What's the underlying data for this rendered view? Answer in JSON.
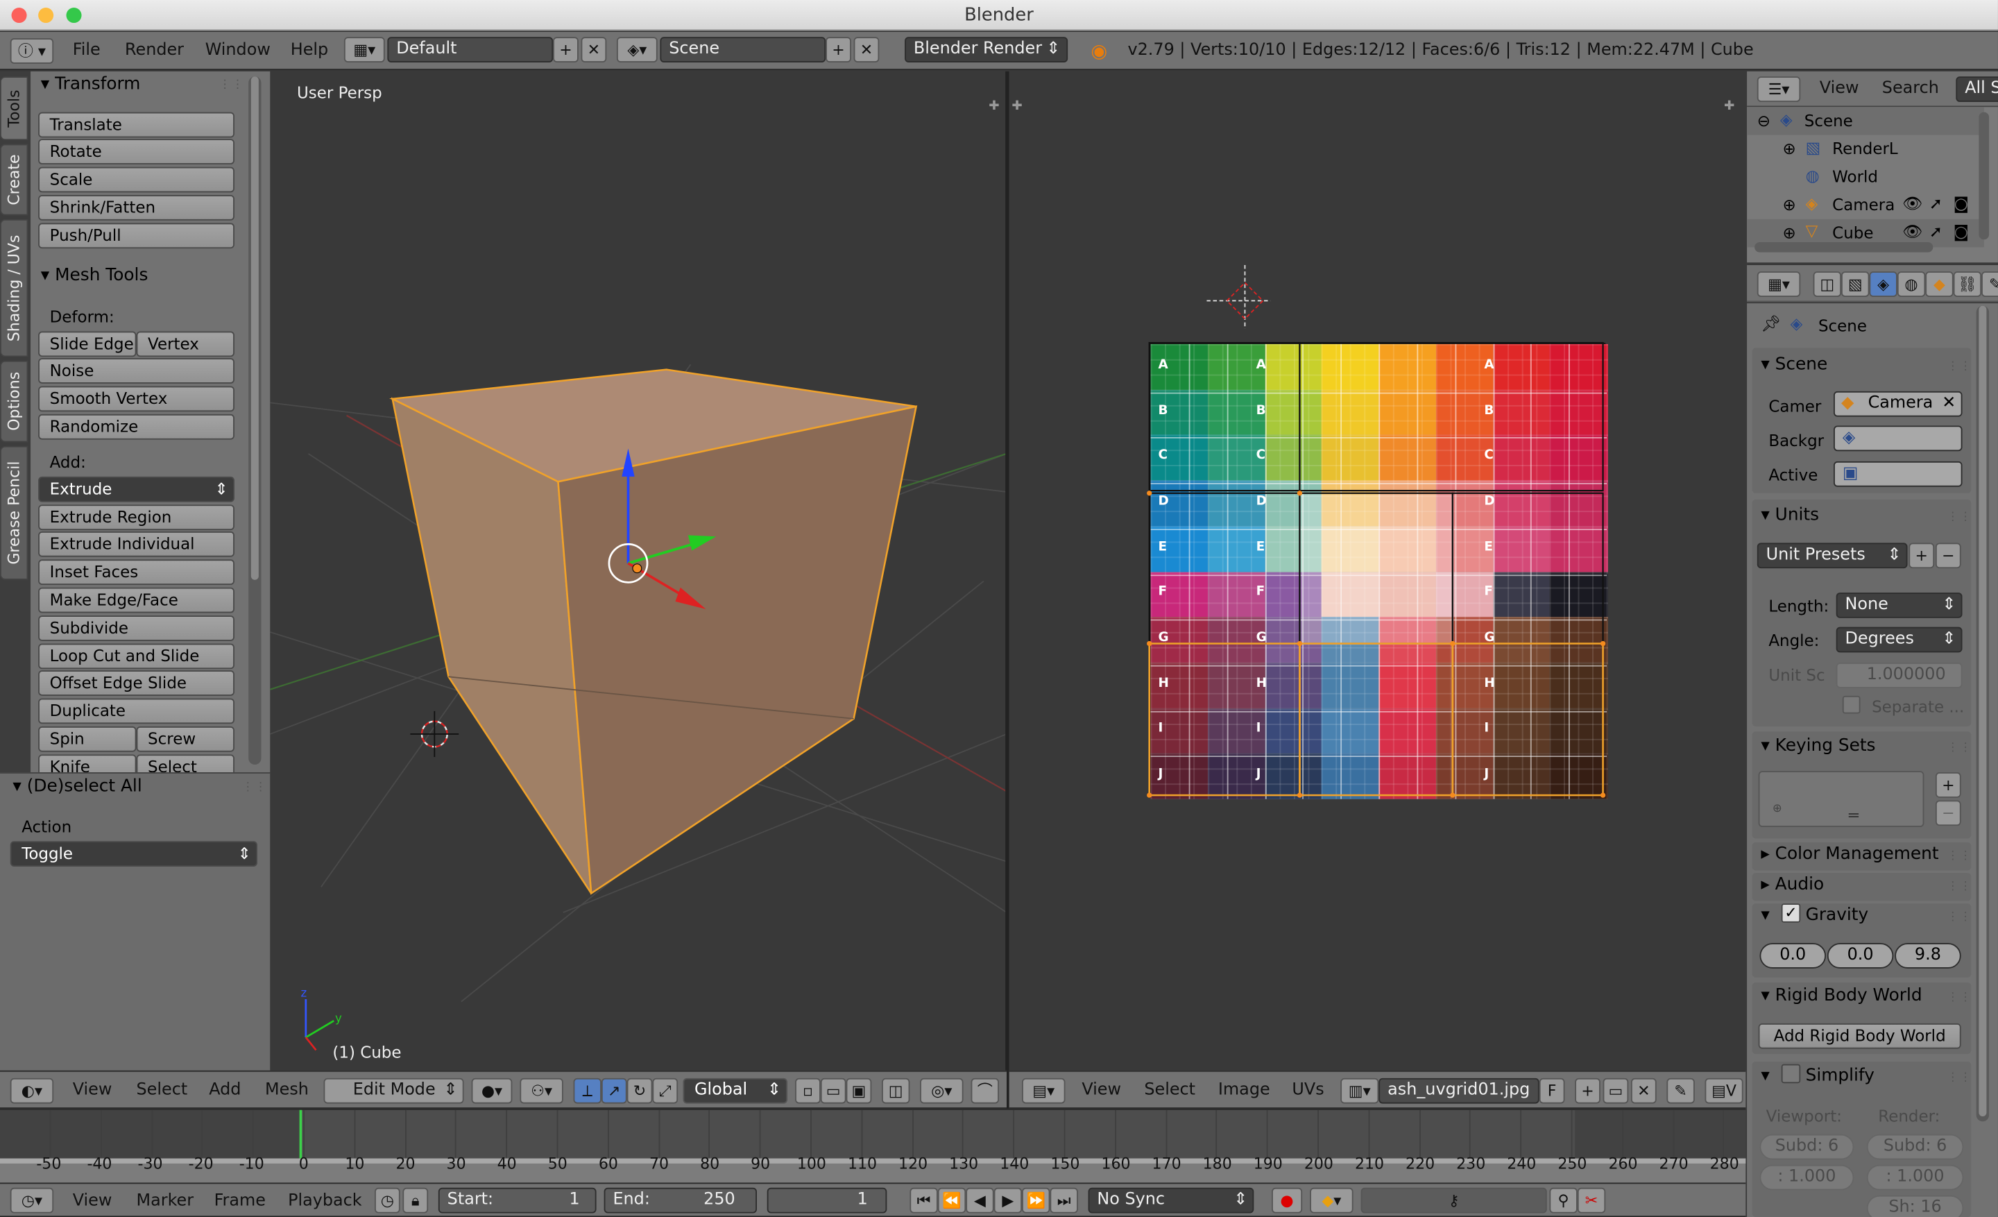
{
  "window": {
    "title": "Blender"
  },
  "info_header": {
    "menus": [
      "File",
      "Render",
      "Window",
      "Help"
    ],
    "layout": "Default",
    "scene": "Scene",
    "engine": "Blender Render",
    "stats": "v2.79 | Verts:10/10 | Edges:12/12 | Faces:6/6 | Tris:12 | Mem:22.47M | Cube"
  },
  "tool_tabs": [
    "Tools",
    "Create",
    "Shading / UVs",
    "Options",
    "Grease Pencil"
  ],
  "toolshelf": {
    "transform_title": "Transform",
    "transform_buttons": [
      "Translate",
      "Rotate",
      "Scale",
      "Shrink/Fatten",
      "Push/Pull"
    ],
    "mesh_tools_title": "Mesh Tools",
    "deform_label": "Deform:",
    "slide_edge": "Slide Edge",
    "vertex": "Vertex",
    "deform_buttons": [
      "Noise",
      "Smooth Vertex",
      "Randomize"
    ],
    "add_label": "Add:",
    "extrude": "Extrude",
    "add_buttons": [
      "Extrude Region",
      "Extrude Individual",
      "Inset Faces",
      "Make Edge/Face",
      "Subdivide",
      "Loop Cut and Slide",
      "Offset Edge Slide",
      "Duplicate"
    ],
    "spin": "Spin",
    "screw": "Screw",
    "knife": "Knife",
    "select": "Select"
  },
  "operator_panel": {
    "title": "(De)select All",
    "action_label": "Action",
    "action_value": "Toggle"
  },
  "viewport": {
    "view_label": "User Persp",
    "object_label": "(1) Cube"
  },
  "view3d_header": {
    "menus": [
      "View",
      "Select",
      "Add",
      "Mesh"
    ],
    "mode": "Edit Mode",
    "orientation": "Global"
  },
  "uv_header": {
    "menus": [
      "View",
      "Select",
      "Image",
      "UVs"
    ],
    "image": "ash_uvgrid01.jpg",
    "f": "F"
  },
  "uv_grid": {
    "rows": [
      "A",
      "B",
      "C",
      "D",
      "E",
      "F",
      "G",
      "H",
      "I",
      "J"
    ],
    "colors": [
      "#1a8a3c",
      "#2e9a55",
      "#a4c82c",
      "#f0d626",
      "#f6a81c",
      "#ec6a1e",
      "#e6341c",
      "#d81a2a"
    ]
  },
  "outliner": {
    "menus": [
      "View",
      "Search",
      "All S"
    ],
    "items": [
      "Scene",
      "RenderL",
      "World",
      "Camera",
      "Cube"
    ]
  },
  "properties": {
    "breadcrumb": "Scene",
    "scene_title": "Scene",
    "camera_label": "Camer",
    "camera_value": "Camera",
    "background_label": "Backgr",
    "active_label": "Active",
    "units_title": "Units",
    "unit_presets": "Unit Presets",
    "length_label": "Length:",
    "length_value": "None",
    "angle_label": "Angle:",
    "angle_value": "Degrees",
    "unit_scale_label": "Unit Sc",
    "unit_scale_value": "1.000000",
    "separate_label": "Separate ...",
    "keying_sets_title": "Keying Sets",
    "color_management": "Color Management",
    "audio": "Audio",
    "gravity": "Gravity",
    "gravity_values": [
      "0.0",
      "0.0",
      "9.8"
    ],
    "rigid_body_world": "Rigid Body World",
    "add_rigid_body_world": "Add Rigid Body World",
    "simplify": "Simplify",
    "viewport_label": "Viewport:",
    "render_label": "Render:",
    "subd_viewport": "Subd: 6",
    "subd_render": "Subd: 6",
    "val_a": ": 1.000",
    "val_b": ": 1.000",
    "sh": "Sh: 16"
  },
  "timeline": {
    "ticks": [
      "-50",
      "-40",
      "-30",
      "-20",
      "-10",
      "0",
      "10",
      "20",
      "30",
      "40",
      "50",
      "60",
      "70",
      "80",
      "90",
      "100",
      "110",
      "120",
      "130",
      "140",
      "150",
      "160",
      "170",
      "180",
      "190",
      "200",
      "210",
      "220",
      "230",
      "240",
      "250",
      "260",
      "270",
      "280"
    ],
    "menus": [
      "View",
      "Marker",
      "Frame",
      "Playback"
    ],
    "start_label": "Start:",
    "start_value": "1",
    "end_label": "End:",
    "end_value": "250",
    "current_frame": "1",
    "sync": "No Sync"
  }
}
